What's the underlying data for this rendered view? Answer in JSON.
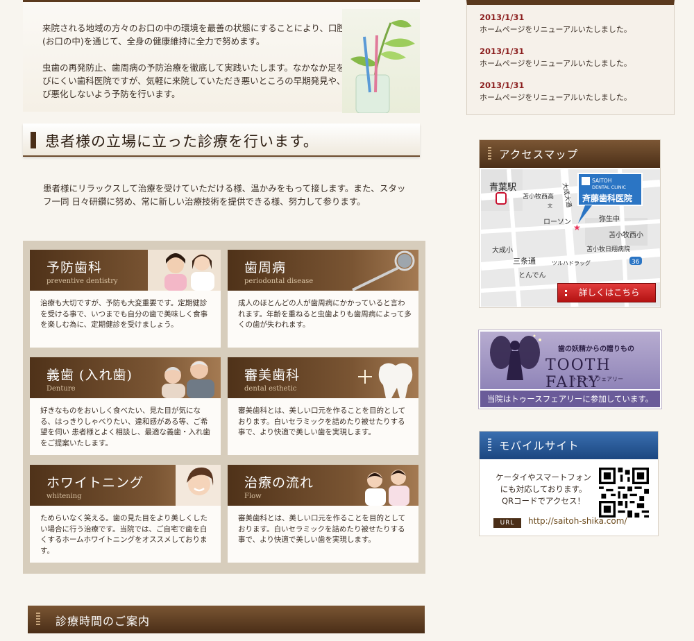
{
  "intro": {
    "para1": "来院される地域の方々のお口の中の環境を最善の状態にすることにより、口腔内(お口の中)を通じて、全身の健康維持に全力で努めます。",
    "para2": "虫歯の再発防止、歯周病の予防治療を徹底して実践いたします。なかなか足を運びにくい歯科医院ですが、気軽に来院していただき悪いところの早期発見や、再び悪化しないよう予防を行います。"
  },
  "patient_section": {
    "heading": "患者様の立場に立った診療を行います。",
    "text": "患者様にリラックスして治療を受けていただける様、温かみをもって接します。また、スタッフ一同 日々研鑽に努め、常に新しい治療技術を提供できる様、努力して参ります。"
  },
  "services": [
    {
      "title": "予防歯科",
      "subtitle": "preventive dentistry",
      "desc": "治療も大切ですが、予防も大変重要です。定期健診を受ける事で、いつまでも自分の歯で美味しく食事を楽しむ為に、定期健診を受けましょう。"
    },
    {
      "title": "歯周病",
      "subtitle": "periodontal disease",
      "desc": "成人のほとんどの人が歯周病にかかっていると言われます。年齢を重ねると虫歯よりも歯周病によって多くの歯が失われます。"
    },
    {
      "title": "義歯 (入れ歯)",
      "subtitle": "Denture",
      "desc": "好きなものをおいしく食べたい、見た目が気になる、はっきりしゃべりたい、違和感がある等、ご希望を伺い 患者様とよく相談し、最適な義歯・入れ歯をご提案いたします。"
    },
    {
      "title": "審美歯科",
      "subtitle": "dental esthetic",
      "desc": "審美歯科とは、美しい口元を作ることを目的としております。白いセラミックを詰めたり被せたりする事で、より快適で美しい歯を実現します。"
    },
    {
      "title": "ホワイトニング",
      "subtitle": "whitening",
      "desc": "ためらいなく笑える。歯の見た目をより美しくしたい場合に行う治療です。当院では、ご自宅で歯を白くするホームホワイトニングをオススメしております。"
    },
    {
      "title": "治療の流れ",
      "subtitle": "Flow",
      "desc": "審美歯科とは、美しい口元を作ることを目的としております。白いセラミックを詰めたり被せたりする事で、より快適で美しい歯を実現します。"
    }
  ],
  "hours_heading": "診療時間のご案内",
  "news": [
    {
      "date": "2013/1/31",
      "text": "ホームページをリニューアルいたしました。"
    },
    {
      "date": "2013/1/31",
      "text": "ホームページをリニューアルいたしました。"
    },
    {
      "date": "2013/1/31",
      "text": "ホームページをリニューアルいたしました。"
    }
  ],
  "access": {
    "heading": "アクセスマップ",
    "station": "青葉駅",
    "clinic_en1": "SAITOH",
    "clinic_en2": "DENTAL CLINIC",
    "clinic_jp": "斉藤歯科医院",
    "labels": {
      "school1": "苫小牧西高",
      "street1": "大成大通",
      "lawson": "ローソン",
      "school2": "弥生中",
      "school3": "苫小牧西小",
      "school4": "大成小",
      "hospital": "苫小牧日翔病院",
      "street2": "三条通",
      "drug": "ツルハドラッグ",
      "tonden": "とんでん",
      "route": "36",
      "bun": "文"
    },
    "button": "詳しくはこちら"
  },
  "tooth_fairy": {
    "subtitle": "歯の妖精からの贈りもの",
    "logo": "TOOTH FAIRY",
    "kana": "トゥース フェアリー",
    "note": "当院はトゥースフェアリーに参加しています。"
  },
  "mobile": {
    "heading": "モバイルサイト",
    "text1": "ケータイやスマートフォン",
    "text2": "にも対応しております。",
    "text3": "QRコードでアクセス！",
    "url_label": "URL",
    "url": "http://saitoh-shika.com/"
  },
  "colors": {
    "brown_dark": "#4a2e17",
    "brown_mid": "#7a5533",
    "news_date": "#8a1c1c",
    "button_red": "#c41c1c",
    "fairy_purple": "#6a5b99",
    "mobile_blue": "#1e4e8c"
  }
}
